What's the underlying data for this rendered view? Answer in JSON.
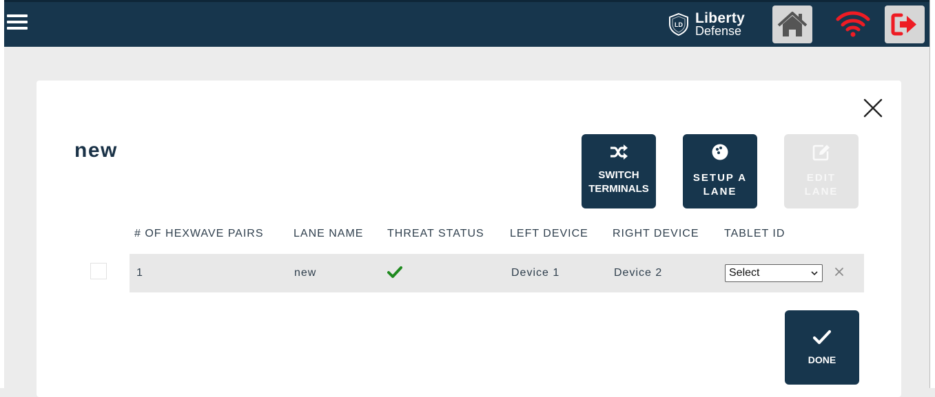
{
  "header": {
    "brand_line1": "Liberty",
    "brand_line2": "Defense",
    "logo_mark_text": "LD",
    "colors": {
      "bar": "#17364d",
      "wifi": "#ee1c24",
      "logout": "#ee1c24",
      "icon_button_bg": "#d6d6d6"
    },
    "icons": [
      "menu-icon",
      "home-icon",
      "wifi-icon",
      "logout-icon"
    ]
  },
  "dialog": {
    "title": "new",
    "actions": [
      {
        "label_line1": "SWITCH",
        "label_line2": "TERMINALS",
        "icon": "shuffle-icon",
        "enabled": true
      },
      {
        "label_line1": "SETUP A",
        "label_line2": "LANE",
        "icon": "bowling-ball-icon",
        "enabled": true
      },
      {
        "label_line1": "EDIT",
        "label_line2": "LANE",
        "icon": "edit-icon",
        "enabled": false
      }
    ],
    "table": {
      "headers": [
        "# OF HEXWAVE PAIRS",
        "LANE NAME",
        "THREAT STATUS",
        "LEFT DEVICE",
        "RIGHT DEVICE",
        "TABLET ID"
      ],
      "rows": [
        {
          "pairs": "1",
          "lane_name": "new",
          "threat_status": "check-icon",
          "left_device": "Device 1",
          "right_device": "Device 2",
          "tablet_id": "Select",
          "selected": false
        }
      ]
    },
    "done_label": "DONE",
    "colors": {
      "primary": "#17364d",
      "disabled": "#e4e4e4",
      "ok_check": "#1f8a1f"
    }
  }
}
